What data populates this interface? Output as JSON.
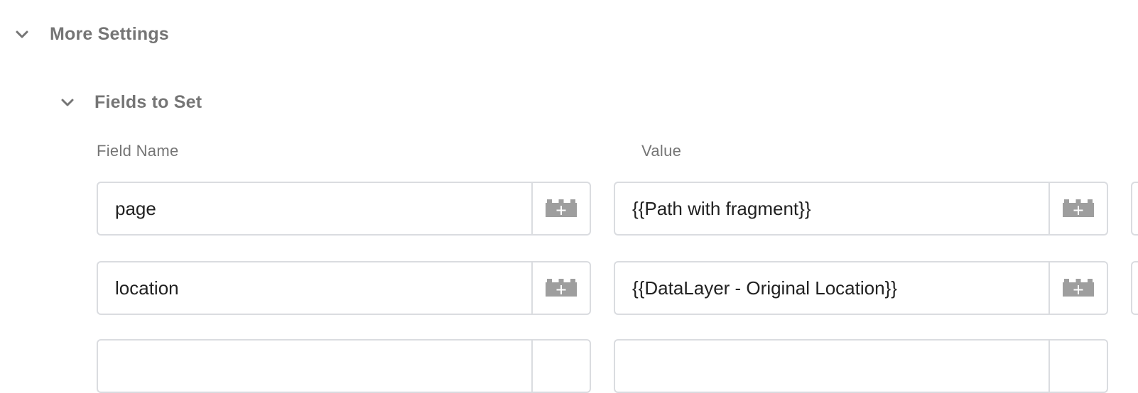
{
  "sections": {
    "more_settings": {
      "title": "More Settings"
    },
    "fields_to_set": {
      "title": "Fields to Set"
    }
  },
  "columns": {
    "field_name": "Field Name",
    "value": "Value"
  },
  "rows": [
    {
      "field_name": "page",
      "value": "{{Path with fragment}}"
    },
    {
      "field_name": "location",
      "value": "{{DataLayer - Original Location}}"
    },
    {
      "field_name": "",
      "value": ""
    }
  ],
  "icons": {
    "chevron": "chevron-down-icon",
    "variable": "add-variable-icon"
  },
  "colors": {
    "section_title": "#757575",
    "label": "#757575",
    "border": "#dadce0",
    "icon": "#9e9e9e",
    "text": "#212121"
  }
}
